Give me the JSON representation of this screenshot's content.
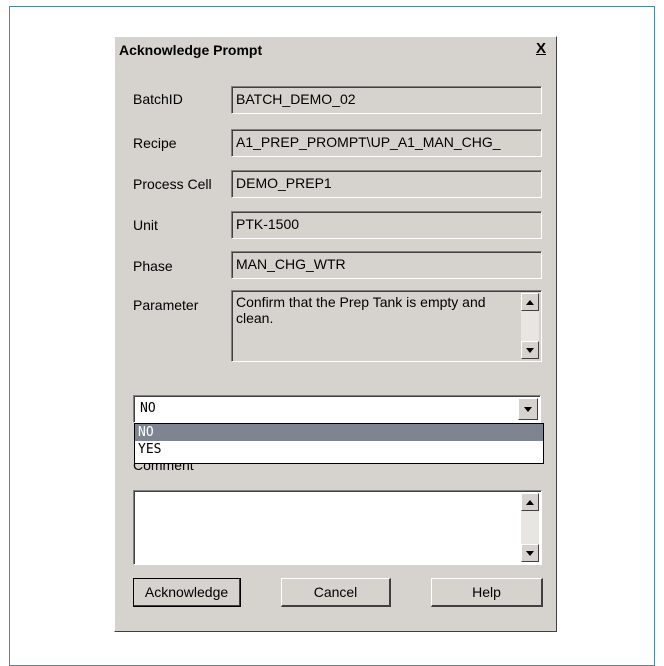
{
  "dialog": {
    "title": "Acknowledge Prompt",
    "close_label": "X"
  },
  "fields": {
    "batch_id": {
      "label": "BatchID",
      "value": "BATCH_DEMO_02"
    },
    "recipe": {
      "label": "Recipe",
      "value": "A1_PREP_PROMPT\\UP_A1_MAN_CHG_"
    },
    "process_cell": {
      "label": "Process Cell",
      "value": "DEMO_PREP1"
    },
    "unit": {
      "label": "Unit",
      "value": "PTK-1500"
    },
    "phase": {
      "label": "Phase",
      "value": "MAN_CHG_WTR"
    },
    "parameter": {
      "label": "Parameter",
      "value": "Confirm that the Prep Tank is empty and clean."
    }
  },
  "response": {
    "selected": "NO",
    "options": [
      "NO",
      "YES"
    ]
  },
  "comment": {
    "label": "Comment",
    "value": ""
  },
  "buttons": {
    "acknowledge": "Acknowledge",
    "cancel": "Cancel",
    "help": "Help"
  },
  "icons": {
    "close": "close-icon",
    "scroll_up": "arrow-up-icon",
    "scroll_down": "arrow-down-icon",
    "dropdown": "chevron-down-icon"
  },
  "colors": {
    "dialog_bg": "#d6d3ce",
    "selection": "#7e8590",
    "frame_border": "#4a86b8"
  }
}
